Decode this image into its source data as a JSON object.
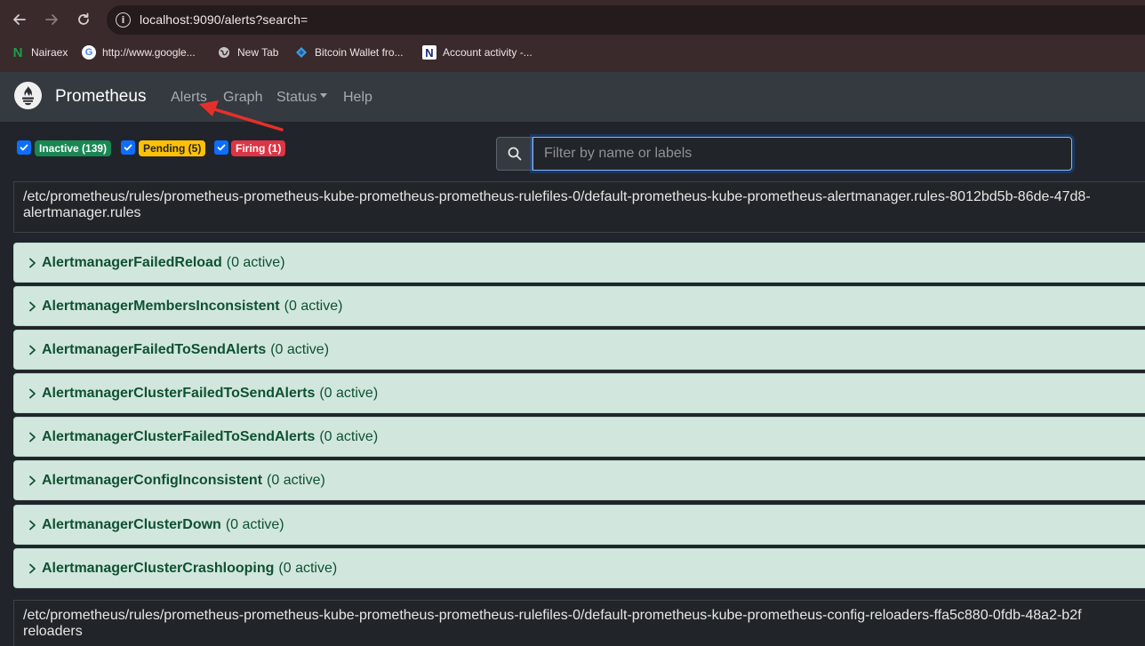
{
  "browser": {
    "url": "localhost:9090/alerts?search=",
    "bookmarks": [
      {
        "label": "Nairaex",
        "icon": "nairaex-icon",
        "glyph": "N",
        "color": "#1e9e4a"
      },
      {
        "label": "http://www.google...",
        "icon": "google-icon",
        "glyph": "G",
        "color": "#4285f4"
      },
      {
        "label": "New Tab",
        "icon": "globe-icon",
        "glyph": "◎",
        "color": "#bbbbbb"
      },
      {
        "label": "Bitcoin Wallet fro...",
        "icon": "bitcoin-wallet-icon",
        "glyph": "◆",
        "color": "#3b9be0"
      },
      {
        "label": "Account activity -...",
        "icon": "account-activity-icon",
        "glyph": "N",
        "color": "#1a2a7a"
      }
    ]
  },
  "navbar": {
    "brand": "Prometheus",
    "links": {
      "alerts": "Alerts",
      "graph": "Graph",
      "status": "Status",
      "help": "Help"
    }
  },
  "filters": {
    "inactive": "Inactive (139)",
    "pending": "Pending (5)",
    "firing": "Firing (1)",
    "search_placeholder": "Filter by name or labels",
    "search_value": ""
  },
  "groups": [
    {
      "path": "/etc/prometheus/rules/prometheus-prometheus-kube-prometheus-prometheus-rulefiles-0/default-prometheus-kube-prometheus-alertmanager.rules-8012bd5b-86de-47d8-",
      "name": "alertmanager.rules",
      "alerts": [
        {
          "name": "AlertmanagerFailedReload",
          "count": "(0 active)"
        },
        {
          "name": "AlertmanagerMembersInconsistent",
          "count": "(0 active)"
        },
        {
          "name": "AlertmanagerFailedToSendAlerts",
          "count": "(0 active)"
        },
        {
          "name": "AlertmanagerClusterFailedToSendAlerts",
          "count": "(0 active)"
        },
        {
          "name": "AlertmanagerClusterFailedToSendAlerts",
          "count": "(0 active)"
        },
        {
          "name": "AlertmanagerConfigInconsistent",
          "count": "(0 active)"
        },
        {
          "name": "AlertmanagerClusterDown",
          "count": "(0 active)"
        },
        {
          "name": "AlertmanagerClusterCrashlooping",
          "count": "(0 active)"
        }
      ]
    },
    {
      "path": "/etc/prometheus/rules/prometheus-prometheus-kube-prometheus-prometheus-rulefiles-0/default-prometheus-kube-prometheus-config-reloaders-ffa5c880-0fdb-48a2-b2f",
      "name": "reloaders",
      "alerts": []
    }
  ],
  "colors": {
    "inactive": "#198754",
    "pending": "#ffc107",
    "firing": "#dc3545",
    "alert_row_bg": "#d1e7dd",
    "alert_text": "#0f5132",
    "annotation_arrow": "#e5302a"
  }
}
